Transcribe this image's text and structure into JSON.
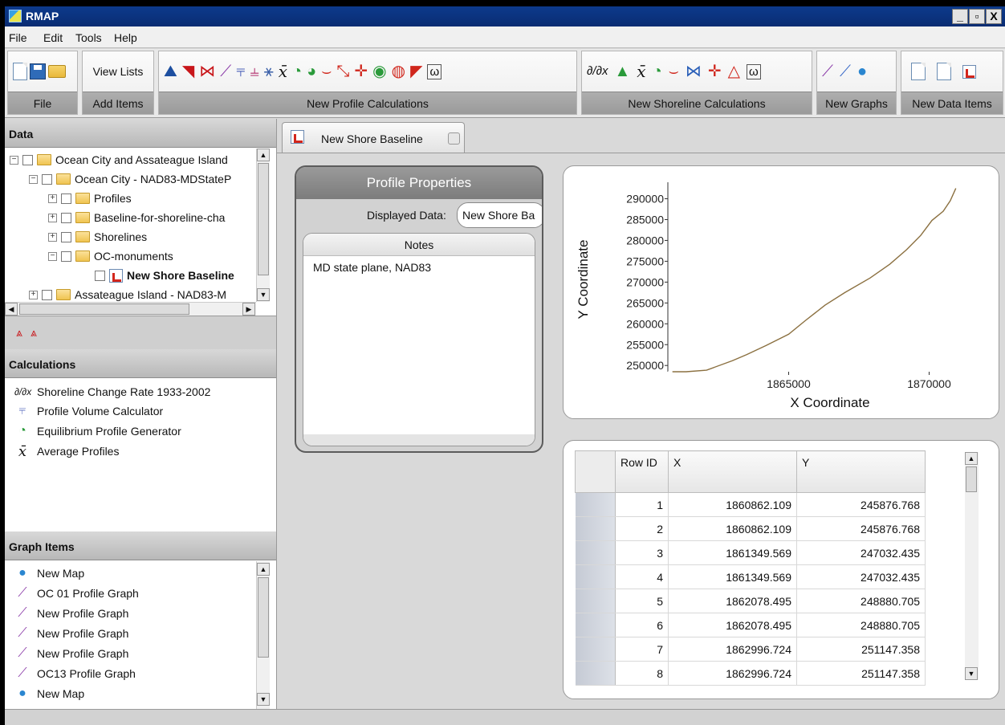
{
  "window": {
    "title": "RMAP",
    "min": "_",
    "restore": "▫",
    "close": "X"
  },
  "menu": [
    "File",
    "Edit",
    "Tools",
    "Help"
  ],
  "ribbon": {
    "groups": [
      {
        "label": "File"
      },
      {
        "label": "Add Items",
        "button": "View Lists"
      },
      {
        "label": "New Profile Calculations"
      },
      {
        "label": "New Shoreline Calculations"
      },
      {
        "label": "New Graphs"
      },
      {
        "label": "New Data Items"
      }
    ]
  },
  "data_panel": {
    "title": "Data",
    "tree": [
      {
        "label": "Ocean City and Assateague Island"
      },
      {
        "label": "Ocean City - NAD83-MDStateP"
      },
      {
        "label": "Profiles"
      },
      {
        "label": "Baseline-for-shoreline-cha"
      },
      {
        "label": "Shorelines"
      },
      {
        "label": "OC-monuments"
      },
      {
        "label": "New Shore Baseline"
      },
      {
        "label": "Assateague Island - NAD83-M"
      }
    ]
  },
  "calculations": {
    "title": "Calculations",
    "items": [
      {
        "label": "Shoreline Change Rate 1933-2002",
        "icon": "derivative-icon"
      },
      {
        "label": "Profile Volume Calculator",
        "icon": "volume-icon"
      },
      {
        "label": "Equilibrium Profile Generator",
        "icon": "equilibrium-icon"
      },
      {
        "label": "Average Profiles",
        "icon": "average-icon"
      }
    ]
  },
  "graph_items": {
    "title": "Graph Items",
    "items": [
      {
        "label": "New Map",
        "icon": "globe-icon"
      },
      {
        "label": "OC 01 Profile Graph",
        "icon": "profile-graph-icon"
      },
      {
        "label": "New Profile Graph",
        "icon": "profile-graph-icon"
      },
      {
        "label": "New Profile Graph",
        "icon": "profile-graph-icon"
      },
      {
        "label": "New Profile Graph",
        "icon": "profile-graph-icon"
      },
      {
        "label": "OC13 Profile Graph",
        "icon": "profile-graph-icon"
      },
      {
        "label": "New Map",
        "icon": "globe-icon"
      }
    ]
  },
  "tab": {
    "label": "New Shore Baseline"
  },
  "properties": {
    "title": "Profile Properties",
    "displayed_label": "Displayed Data:",
    "displayed_value": "New Shore Ba",
    "notes_header": "Notes",
    "notes_text": "MD state plane, NAD83"
  },
  "chart_data": {
    "type": "line",
    "xlabel": "X Coordinate",
    "ylabel": "Y Coordinate",
    "xlim": [
      1860700,
      1871100
    ],
    "ylim": [
      248500,
      292800
    ],
    "xticks": [
      1865000,
      1870000
    ],
    "xtick_labels": [
      "1865000",
      "1870000"
    ],
    "yticks": [
      250000,
      255000,
      260000,
      265000,
      270000,
      275000,
      280000,
      285000,
      290000
    ],
    "ytick_labels": [
      "250000",
      "255000",
      "260000",
      "265000",
      "270000",
      "275000",
      "280000",
      "285000",
      "290000"
    ],
    "grid": false,
    "color": "#8b7040",
    "series": [
      {
        "x": [
          1860862,
          1861350,
          1862078,
          1862997,
          1863500,
          1864200,
          1865000,
          1865600,
          1866300,
          1867000,
          1867900,
          1868600,
          1869200,
          1869700,
          1870100,
          1870500,
          1870750,
          1870950
        ],
        "y": [
          245877,
          247032,
          248881,
          251147,
          252600,
          254800,
          257500,
          260800,
          264500,
          267500,
          271000,
          274300,
          277800,
          281200,
          284800,
          287000,
          289500,
          292500
        ]
      }
    ]
  },
  "table": {
    "headers": [
      "Row ID",
      "X",
      "Y"
    ],
    "rows": [
      [
        "1",
        "1860862.109",
        "245876.768"
      ],
      [
        "2",
        "1860862.109",
        "245876.768"
      ],
      [
        "3",
        "1861349.569",
        "247032.435"
      ],
      [
        "4",
        "1861349.569",
        "247032.435"
      ],
      [
        "5",
        "1862078.495",
        "248880.705"
      ],
      [
        "6",
        "1862078.495",
        "248880.705"
      ],
      [
        "7",
        "1862996.724",
        "251147.358"
      ],
      [
        "8",
        "1862996.724",
        "251147.358"
      ]
    ]
  }
}
